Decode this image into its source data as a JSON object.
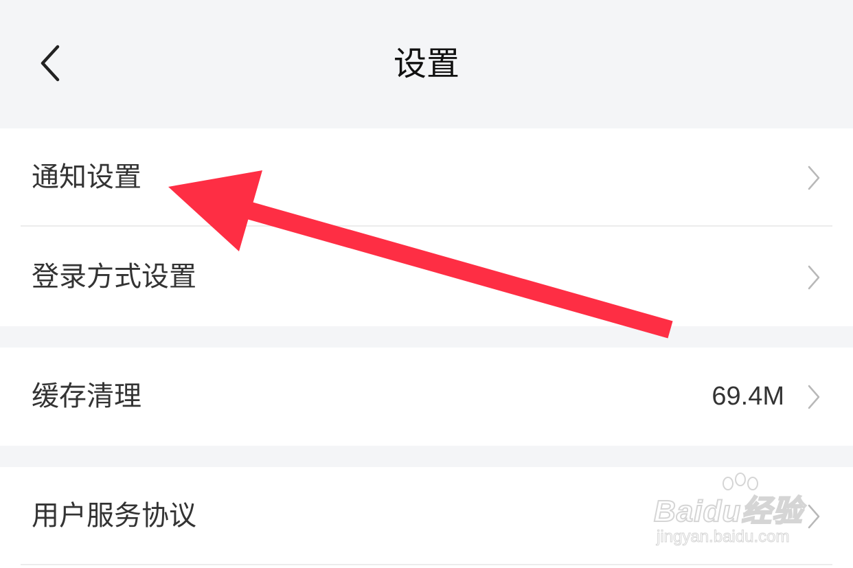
{
  "header": {
    "title": "设置",
    "back_icon": "chevron-left-icon"
  },
  "groups": [
    {
      "items": [
        {
          "label": "通知设置"
        },
        {
          "label": "登录方式设置"
        }
      ]
    },
    {
      "items": [
        {
          "label": "缓存清理",
          "value": "69.4M"
        }
      ]
    },
    {
      "items": [
        {
          "label": "用户服务协议"
        }
      ]
    }
  ],
  "annotation": {
    "color": "#fe2e44",
    "icon": "red-arrow-pointer"
  },
  "watermark": {
    "brand": "Baidu经验",
    "url": "jingyan.baidu.com"
  },
  "colors": {
    "background": "#f4f5f7",
    "card": "#ffffff",
    "text": "#333333",
    "chevron": "#b8b8b8"
  }
}
